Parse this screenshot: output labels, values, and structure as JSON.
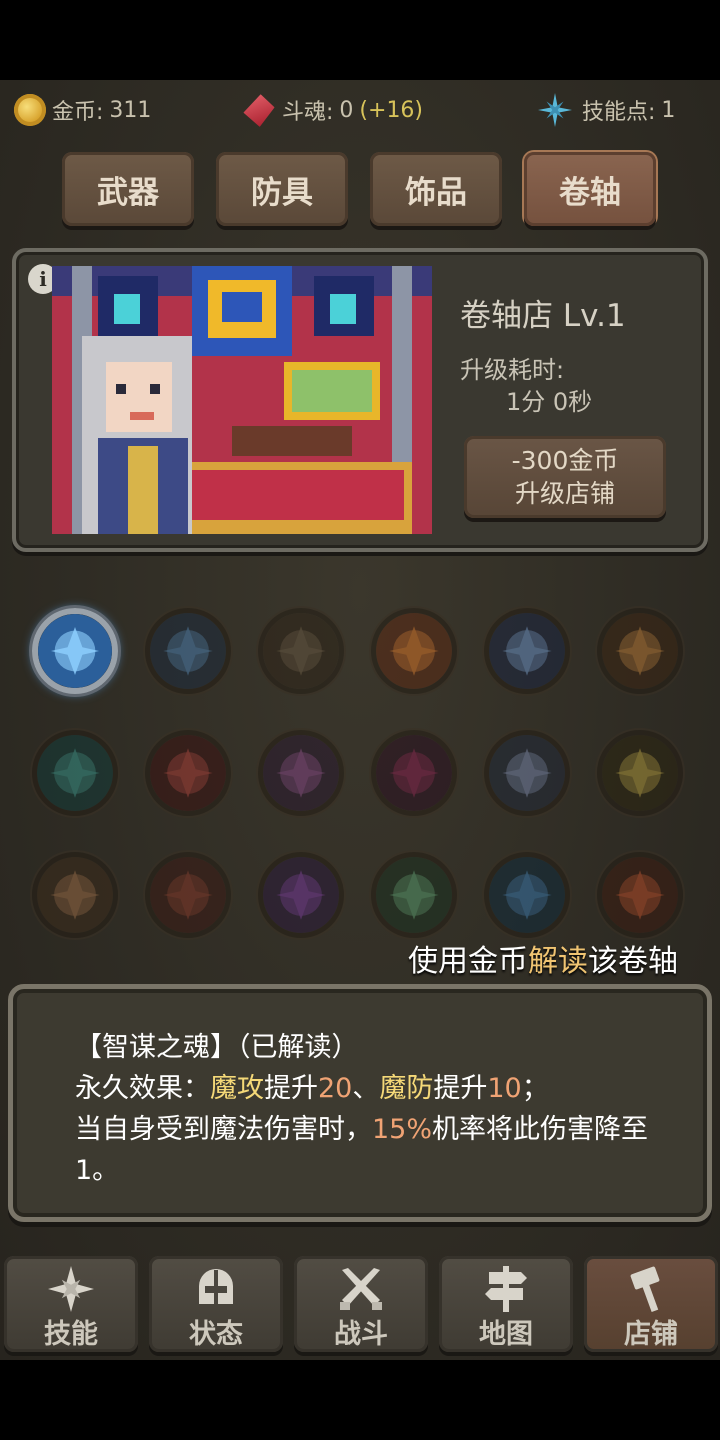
{
  "resources": {
    "gold_label": "金币:",
    "gold_value": "311",
    "soul_label": "斗魂:",
    "soul_value": "0",
    "soul_bonus": "(+16)",
    "skill_label": "技能点:",
    "skill_value": "1"
  },
  "tabs": [
    {
      "label": "武器",
      "active": false
    },
    {
      "label": "防具",
      "active": false
    },
    {
      "label": "饰品",
      "active": false
    },
    {
      "label": "卷轴",
      "active": true
    }
  ],
  "shop": {
    "info_icon": "i",
    "title": "卷轴店 Lv.1",
    "upgrade_time_label": "升级耗时:",
    "upgrade_time_value": "1分 0秒",
    "upgrade_cost": "-300金币",
    "upgrade_action": "升级店铺"
  },
  "scrolls": [
    {
      "icon": "ice-crystal-icon",
      "unlocked": true
    },
    {
      "icon": "slash-icon",
      "unlocked": false
    },
    {
      "icon": "rune-circle-icon",
      "unlocked": false
    },
    {
      "icon": "fire-burst-icon",
      "unlocked": false
    },
    {
      "icon": "frost-tree-icon",
      "unlocked": false
    },
    {
      "icon": "flame-icon",
      "unlocked": false
    },
    {
      "icon": "vortex-icon",
      "unlocked": false
    },
    {
      "icon": "blood-slash-icon",
      "unlocked": false
    },
    {
      "icon": "shadow-icon",
      "unlocked": false
    },
    {
      "icon": "demon-mask-icon",
      "unlocked": false
    },
    {
      "icon": "spikes-icon",
      "unlocked": false
    },
    {
      "icon": "thunder-icon",
      "unlocked": false
    },
    {
      "icon": "shield-icon",
      "unlocked": false
    },
    {
      "icon": "spiral-icon",
      "unlocked": false
    },
    {
      "icon": "net-icon",
      "unlocked": false
    },
    {
      "icon": "heart-icon",
      "unlocked": false
    },
    {
      "icon": "water-icon",
      "unlocked": false
    },
    {
      "icon": "fire-orb-icon",
      "unlocked": false
    }
  ],
  "hint": {
    "pre": "使用金币",
    "highlight": "解读",
    "post": "该卷轴"
  },
  "description": {
    "title": "【智谋之魂】（已解读）",
    "line1_pre": "永久效果：",
    "line1_stat1": "魔攻",
    "line1_mid1": "提升",
    "line1_val1": "20",
    "line1_sep": "、",
    "line1_stat2": "魔防",
    "line1_mid2": "提升",
    "line1_val2": "10",
    "line1_end": "；",
    "line2_pre": "当自身受到魔法伤害时，",
    "line2_pct": "15%",
    "line2_post": "机率将此伤害降至1。"
  },
  "nav": [
    {
      "label": "技能",
      "icon": "sparkle-icon"
    },
    {
      "label": "状态",
      "icon": "helmet-icon"
    },
    {
      "label": "战斗",
      "icon": "crossed-swords-icon"
    },
    {
      "label": "地图",
      "icon": "signpost-icon"
    },
    {
      "label": "店铺",
      "icon": "hammer-icon"
    }
  ],
  "colors": {
    "highlight_yellow": "#f5d978",
    "highlight_orange": "#f0a374",
    "hint_highlight": "#f0c472"
  }
}
